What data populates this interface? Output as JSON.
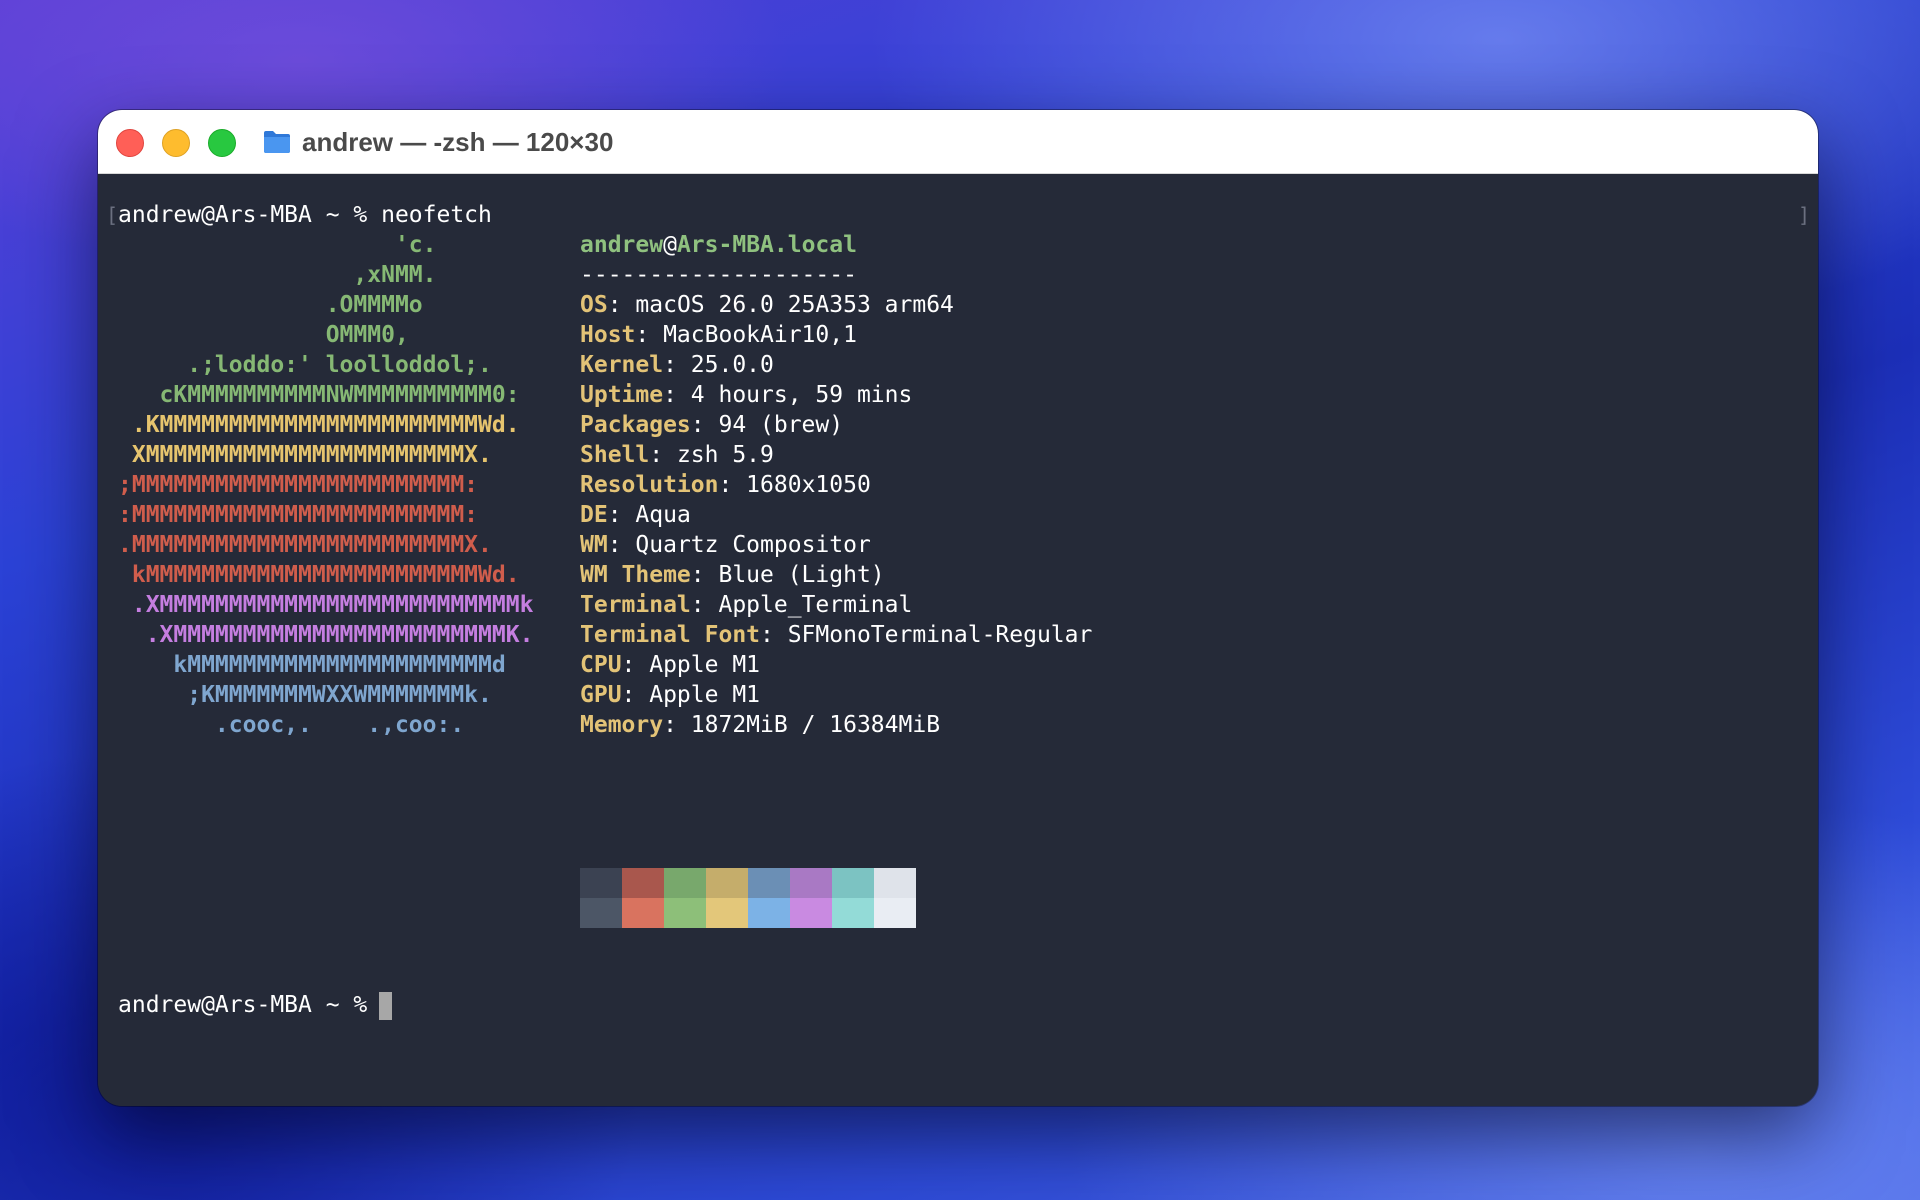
{
  "window": {
    "title": "andrew — -zsh — 120×30",
    "folder_icon": "folder-icon"
  },
  "colors": {
    "art_green": "#86b874",
    "art_yellow": "#e6c46e",
    "art_red": "#d05d4c",
    "art_purple": "#c57ee0",
    "art_blue": "#7fa6cf",
    "key_yellow": "#e3c377",
    "header_green": "#8fc17f",
    "terminal_bg": "#252a38"
  },
  "terminal": {
    "command_line": "andrew@Ars-MBA ~ % neofetch",
    "prompt": "andrew@Ars-MBA ~ %",
    "art": [
      {
        "text": "                    'c.",
        "color": "green"
      },
      {
        "text": "                 ,xNMM.",
        "color": "green"
      },
      {
        "text": "               .OMMMMo",
        "color": "green"
      },
      {
        "text": "               OMMM0,",
        "color": "green"
      },
      {
        "text": "     .;loddo:' loolloddol;.",
        "color": "green"
      },
      {
        "text": "   cKMMMMMMMMMMNWMMMMMMMMMM0:",
        "color": "green"
      },
      {
        "text": " .KMMMMMMMMMMMMMMMMMMMMMMMWd.",
        "color": "yellow"
      },
      {
        "text": " XMMMMMMMMMMMMMMMMMMMMMMMX.",
        "color": "yellow"
      },
      {
        "text": ";MMMMMMMMMMMMMMMMMMMMMMMM:",
        "color": "red"
      },
      {
        "text": ":MMMMMMMMMMMMMMMMMMMMMMMM:",
        "color": "red"
      },
      {
        "text": ".MMMMMMMMMMMMMMMMMMMMMMMMX.",
        "color": "red"
      },
      {
        "text": " kMMMMMMMMMMMMMMMMMMMMMMMMWd.",
        "color": "red"
      },
      {
        "text": " .XMMMMMMMMMMMMMMMMMMMMMMMMMMk",
        "color": "purple"
      },
      {
        "text": "  .XMMMMMMMMMMMMMMMMMMMMMMMMK.",
        "color": "purple"
      },
      {
        "text": "    kMMMMMMMMMMMMMMMMMMMMMMd",
        "color": "blue"
      },
      {
        "text": "     ;KMMMMMMMWXXWMMMMMMMk.",
        "color": "blue"
      },
      {
        "text": "       .cooc,.    .,coo:.",
        "color": "blue"
      }
    ],
    "header": {
      "user": "andrew",
      "at": "@",
      "host": "Ars-MBA.local",
      "separator": "--------------------"
    },
    "info": [
      {
        "key": "OS",
        "value": ": macOS 26.0 25A353 arm64"
      },
      {
        "key": "Host",
        "value": ": MacBookAir10,1"
      },
      {
        "key": "Kernel",
        "value": ": 25.0.0"
      },
      {
        "key": "Uptime",
        "value": ": 4 hours, 59 mins"
      },
      {
        "key": "Packages",
        "value": ": 94 (brew)"
      },
      {
        "key": "Shell",
        "value": ": zsh 5.9"
      },
      {
        "key": "Resolution",
        "value": ": 1680x1050"
      },
      {
        "key": "DE",
        "value": ": Aqua"
      },
      {
        "key": "WM",
        "value": ": Quartz Compositor"
      },
      {
        "key": "WM Theme",
        "value": ": Blue (Light)"
      },
      {
        "key": "Terminal",
        "value": ": Apple_Terminal"
      },
      {
        "key": "Terminal Font",
        "value": ": SFMonoTerminal-Regular"
      },
      {
        "key": "CPU",
        "value": ": Apple M1"
      },
      {
        "key": "GPU",
        "value": ": Apple M1"
      },
      {
        "key": "Memory",
        "value": ": 1872MiB / 16384MiB"
      }
    ],
    "palette_normal": [
      "#3b4252",
      "#a9574d",
      "#78a86c",
      "#c5ad6b",
      "#6b8fb5",
      "#a979c4",
      "#7cc3c2",
      "#dfe3ea"
    ],
    "palette_bright": [
      "#4c5666",
      "#d9735f",
      "#8dbf79",
      "#e3c77a",
      "#7cb2e6",
      "#c98ae1",
      "#93dbd7",
      "#e9edf3"
    ]
  }
}
